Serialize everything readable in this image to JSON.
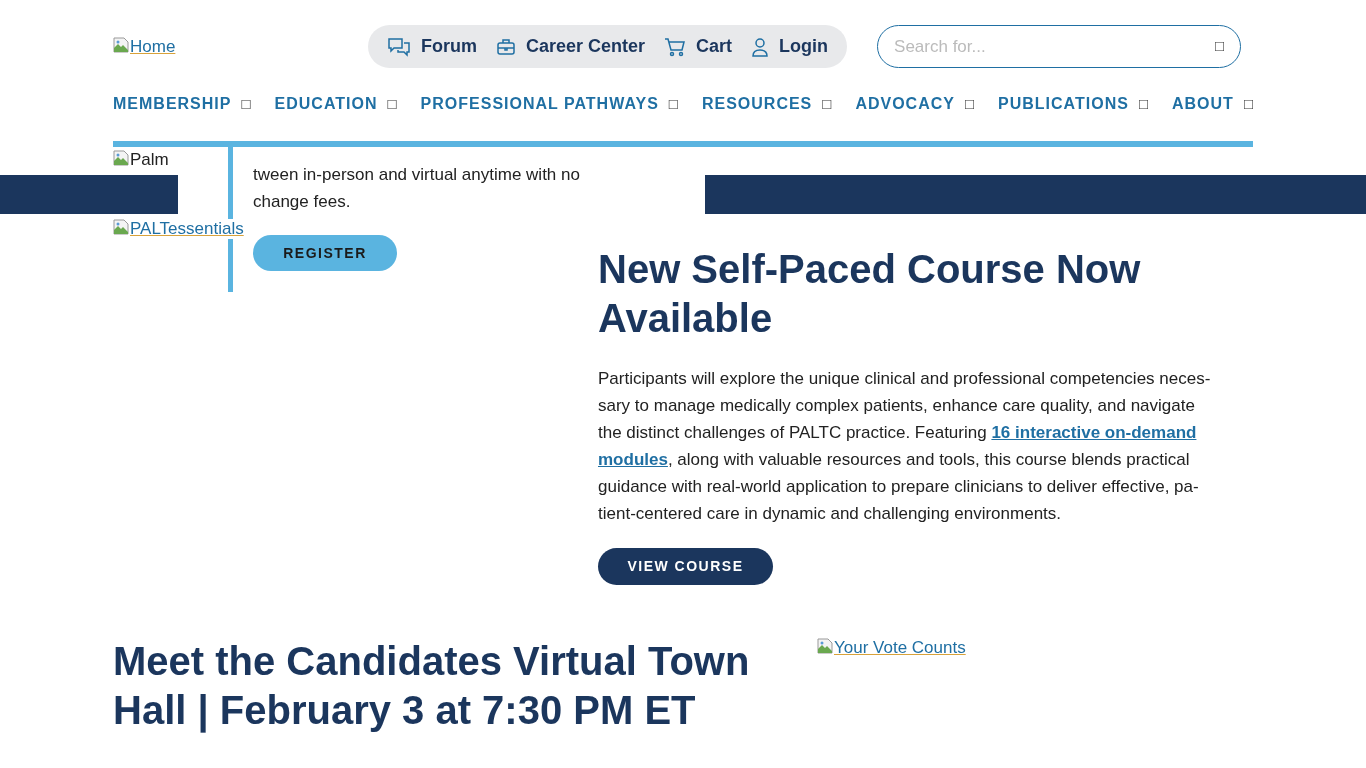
{
  "header": {
    "logo_alt": "Home",
    "utility_links": [
      {
        "label": "Forum"
      },
      {
        "label": "Career Center"
      },
      {
        "label": "Cart"
      },
      {
        "label": "Login"
      }
    ],
    "search": {
      "placeholder": "Search for...",
      "button_glyph": "□"
    },
    "nav": [
      {
        "label": "MEMBERSHIP"
      },
      {
        "label": "EDUCATION"
      },
      {
        "label": "PROFESSIONAL PATHWAYS"
      },
      {
        "label": "RESOURCES"
      },
      {
        "label": "ADVOCACY"
      },
      {
        "label": "PUBLICATIONS"
      },
      {
        "label": "ABOUT"
      }
    ],
    "nav_caret_glyph": "□"
  },
  "overlay_panel": {
    "lines": [
      "tween in-person and virtual anytime with no",
      "change fees."
    ],
    "button": "REGISTER"
  },
  "banner": {
    "image_alt": "Palm"
  },
  "course": {
    "image_alt": "PALTessentials",
    "title": "New Self-Paced Course Now Available",
    "body_lines": [
      [
        {
          "kind": "text",
          "text": "Participants will explore the unique clinical and professional competencies neces-"
        }
      ],
      [
        {
          "kind": "text",
          "text": "sary to manage medically complex patients, enhance care quality, and navigate"
        }
      ],
      [
        {
          "kind": "text",
          "text": "the distinct challenges of PALTC practice. Featuring "
        },
        {
          "kind": "link",
          "text": "16 interactive on-demand"
        }
      ],
      [
        {
          "kind": "link",
          "text": "modules"
        },
        {
          "kind": "text",
          "text": ", along with valuable resources and tools, this course blends practical"
        }
      ],
      [
        {
          "kind": "text",
          "text": "guidance with real-world application to prepare clinicians to deliver effective, pa-"
        }
      ],
      [
        {
          "kind": "text",
          "text": "tient-centered care in dynamic and challenging environments."
        }
      ]
    ],
    "button": "VIEW COURSE"
  },
  "town_hall": {
    "title": "Meet the Candidates Virtual Town Hall | February 3 at 7:30 PM ET",
    "image_alt": "Your Vote Counts"
  }
}
